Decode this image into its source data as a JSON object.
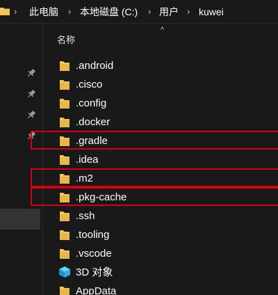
{
  "breadcrumb": {
    "items": [
      "此电脑",
      "本地磁盘 (C:)",
      "用户",
      "kuwei"
    ],
    "separator": "›"
  },
  "header": {
    "name_column": "名称",
    "sort_indicator": "^"
  },
  "files": [
    {
      "name": ".android",
      "icon": "folder-icon",
      "highlighted": false
    },
    {
      "name": ".cisco",
      "icon": "folder-icon",
      "highlighted": false
    },
    {
      "name": ".config",
      "icon": "folder-icon",
      "highlighted": false
    },
    {
      "name": ".docker",
      "icon": "folder-icon",
      "highlighted": false
    },
    {
      "name": ".gradle",
      "icon": "folder-icon",
      "highlighted": true
    },
    {
      "name": ".idea",
      "icon": "folder-icon",
      "highlighted": false
    },
    {
      "name": ".m2",
      "icon": "folder-icon",
      "highlighted": true
    },
    {
      "name": ".pkg-cache",
      "icon": "folder-icon",
      "highlighted": true
    },
    {
      "name": ".ssh",
      "icon": "folder-icon",
      "highlighted": false
    },
    {
      "name": ".tooling",
      "icon": "folder-icon",
      "highlighted": false
    },
    {
      "name": ".vscode",
      "icon": "folder-icon",
      "highlighted": false
    },
    {
      "name": "3D 对象",
      "icon": "3d-objects-icon",
      "highlighted": false
    },
    {
      "name": "AppData",
      "icon": "folder-icon",
      "highlighted": false
    }
  ],
  "sidebar": {
    "pinned_icons": [
      "pin-icon",
      "pin-icon",
      "pin-icon",
      "pin-icon"
    ]
  },
  "colors": {
    "background": "#191919",
    "folder": "#f2c55c",
    "highlight": "#d9000f",
    "selected": "#333333"
  }
}
